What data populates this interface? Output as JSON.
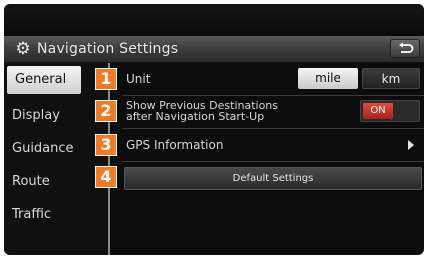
{
  "header": {
    "title": "Navigation Settings",
    "title_icon": "gear-icon",
    "back_icon": "back-arrow-icon"
  },
  "sidebar": {
    "items": [
      {
        "label": "General",
        "active": true
      },
      {
        "label": "Display",
        "active": false
      },
      {
        "label": "Guidance",
        "active": false
      },
      {
        "label": "Route",
        "active": false
      },
      {
        "label": "Traffic",
        "active": false
      }
    ]
  },
  "main": {
    "unit": {
      "badge": "1",
      "label": "Unit",
      "option_mile": "mile",
      "option_km": "km",
      "selected": "mile"
    },
    "prev_dest": {
      "badge": "2",
      "label_line1": "Show Previous Destinations",
      "label_line2": "after Navigation Start-Up",
      "toggle": "ON"
    },
    "gps": {
      "badge": "3",
      "label": "GPS Information",
      "arrow_icon": "chevron-right-icon"
    },
    "default": {
      "badge": "4",
      "label": "Default Settings"
    }
  },
  "colors": {
    "badge": "#f07a23",
    "toggle_on": "#c8322a",
    "selected": "#e0e0e0"
  }
}
